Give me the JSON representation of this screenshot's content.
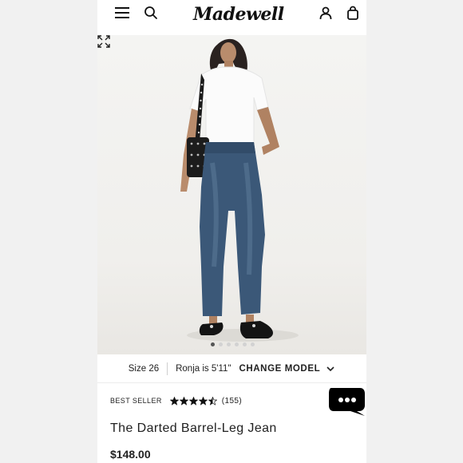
{
  "header": {
    "logo_text": "Madewell",
    "icons": [
      "menu-icon",
      "search-icon",
      "account-icon",
      "bag-icon"
    ]
  },
  "hero": {
    "carousel_count": 6,
    "carousel_active": 1
  },
  "model_bar": {
    "size_label": "Size 26",
    "model_info": "Ronja is 5'11\"",
    "change_label": "CHANGE MODEL"
  },
  "product": {
    "badge": "BEST SELLER",
    "rating": 4.5,
    "rating_max": 5,
    "review_count": "(155)",
    "title": "The Darted Barrel-Leg Jean",
    "price": "$148.00"
  },
  "colors": {
    "accent": "#111111",
    "denim": "#3b5878",
    "background": "#f0efec"
  }
}
